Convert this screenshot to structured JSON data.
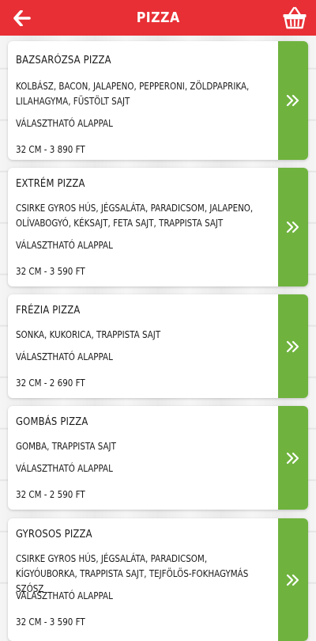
{
  "header": {
    "title": "PIZZA",
    "back_icon": "arrow-left-icon",
    "cart_icon": "basket-icon",
    "bar_color": "#e72f35"
  },
  "theme": {
    "accent_green": "#6fb33e",
    "card_bg": "#ffffff"
  },
  "items": [
    {
      "name": "BAZSARÓZSA PIZZA",
      "ingredients": "KOLBÁSZ, BACON, JALAPENO, PEPPERONI, ZÖLDPAPRIKA, LILAHAGYMA, FÜSTÖLT SAJT",
      "base": "VÁLASZTHATÓ ALAPPAL",
      "price": "32 CM - 3 890 FT"
    },
    {
      "name": "EXTRÉM PIZZA",
      "ingredients": "CSIRKE GYROS HÚS, JÉGSALÁTA, PARADICSOM, JALAPENO, OLÍVABOGYÓ, KÉKSAJT, FETA SAJT, TRAPPISTA SAJT",
      "base": "VÁLASZTHATÓ ALAPPAL",
      "price": "32 CM - 3 590 FT"
    },
    {
      "name": "FRÉZIA PIZZA",
      "ingredients": "SONKA, KUKORICA, TRAPPISTA SAJT",
      "base": "VÁLASZTHATÓ ALAPPAL",
      "price": "32 CM - 2 690 FT"
    },
    {
      "name": "GOMBÁS PIZZA",
      "ingredients": "GOMBA, TRAPPISTA SAJT",
      "base": "VÁLASZTHATÓ ALAPPAL",
      "price": "32 CM - 2 590 FT"
    },
    {
      "name": "GYROSOS PIZZA",
      "ingredients": "CSIRKE GYROS HÚS, JÉGSALÁTA, PARADICSOM, KÍGYÓUBORKA, TRAPPISTA SAJT, TEJFÖLÖS-FOKHAGYMÁS SZÓSZ",
      "base": "VÁLASZTHATÓ ALAPPAL",
      "price": "32 CM - 3 590 FT"
    }
  ]
}
